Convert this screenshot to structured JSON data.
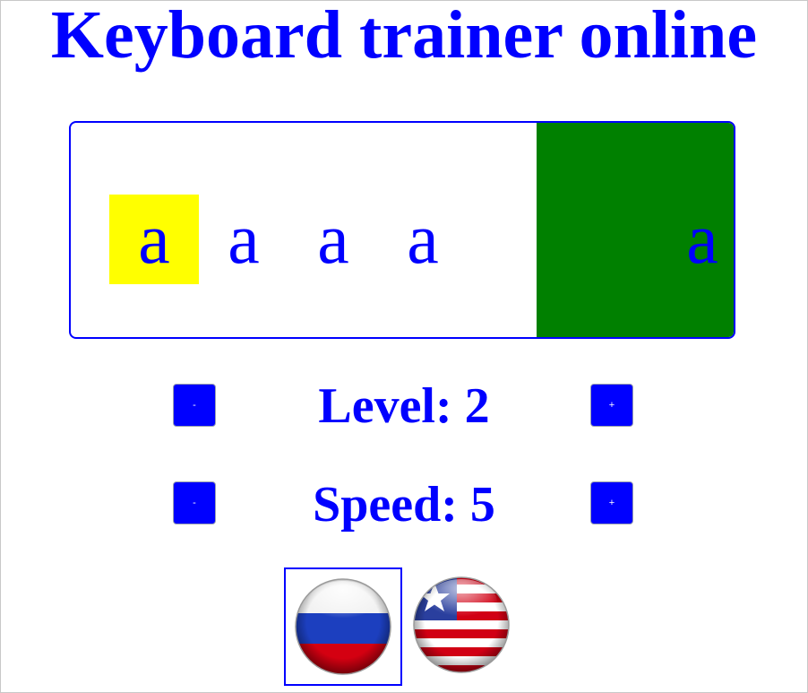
{
  "header": {
    "title": "Keyboard trainer online"
  },
  "trainer": {
    "letters": [
      "a",
      "a",
      "a",
      "a"
    ],
    "falling_letter": "a",
    "colors": {
      "current_highlight": "#ffff00",
      "target_zone": "#008000",
      "letter": "#0000ff"
    }
  },
  "controls": {
    "level": {
      "text": "Level: 2",
      "decrease_label": "-",
      "increase_label": "+"
    },
    "speed": {
      "text": "Speed: 5",
      "decrease_label": "-",
      "increase_label": "+"
    }
  },
  "languages": {
    "selected": "russian",
    "options": [
      {
        "id": "russian",
        "icon": "russia-flag-icon"
      },
      {
        "id": "english",
        "icon": "liberia-flag-icon"
      }
    ]
  }
}
